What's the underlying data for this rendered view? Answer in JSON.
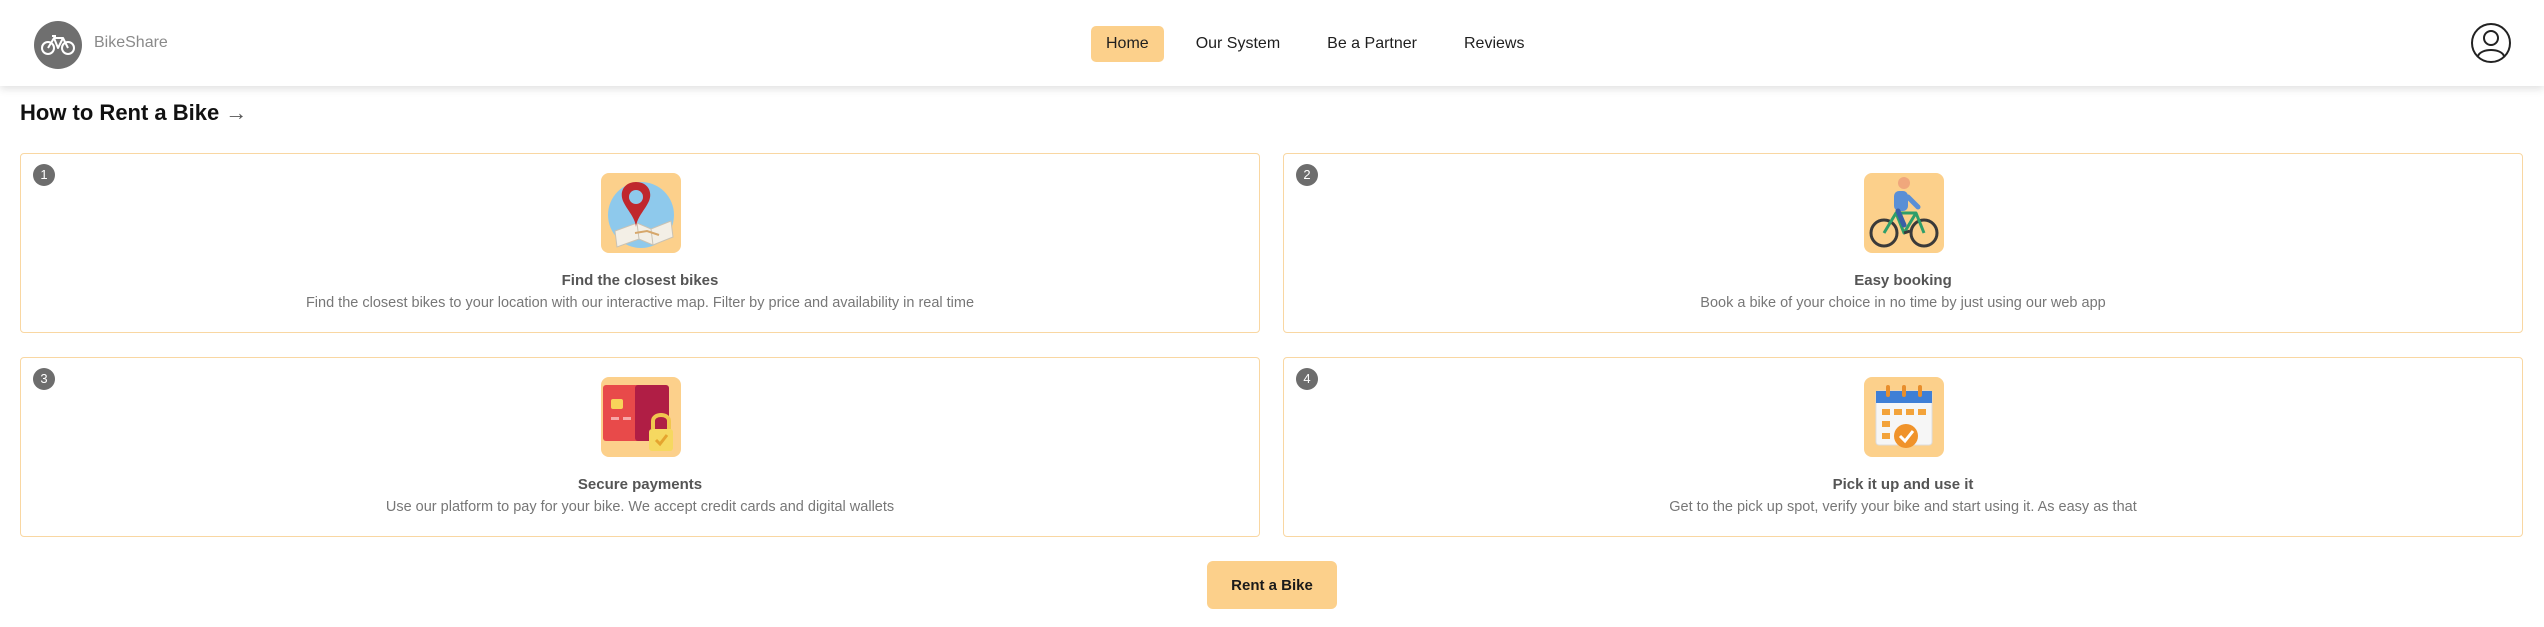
{
  "header": {
    "brand": "BikeShare",
    "nav": [
      "Home",
      "Our System",
      "Be a Partner",
      "Reviews"
    ],
    "active_nav": "Home"
  },
  "section": {
    "title": "How to Rent a Bike",
    "arrow": "→"
  },
  "steps": [
    {
      "number": "1",
      "title": "Find the closest bikes",
      "description": "Find the closest bikes to your location with our interactive map. Filter by price and availability in real time",
      "icon": "map-pin-icon"
    },
    {
      "number": "2",
      "title": "Easy booking",
      "description": "Book a bike of your choice in no time by just using our web app",
      "icon": "cyclist-icon"
    },
    {
      "number": "3",
      "title": "Secure payments",
      "description": "Use our platform to pay for your bike. We accept credit cards and digital wallets",
      "icon": "credit-card-lock-icon"
    },
    {
      "number": "4",
      "title": "Pick it up and use it",
      "description": "Get to the pick up spot, verify your bike and start using it. As easy as that",
      "icon": "calendar-check-icon"
    }
  ],
  "cta": {
    "label": "Rent a Bike"
  },
  "colors": {
    "accent": "#fcd08b",
    "card_border": "#f9d7a2",
    "badge": "#6d6d6d"
  }
}
